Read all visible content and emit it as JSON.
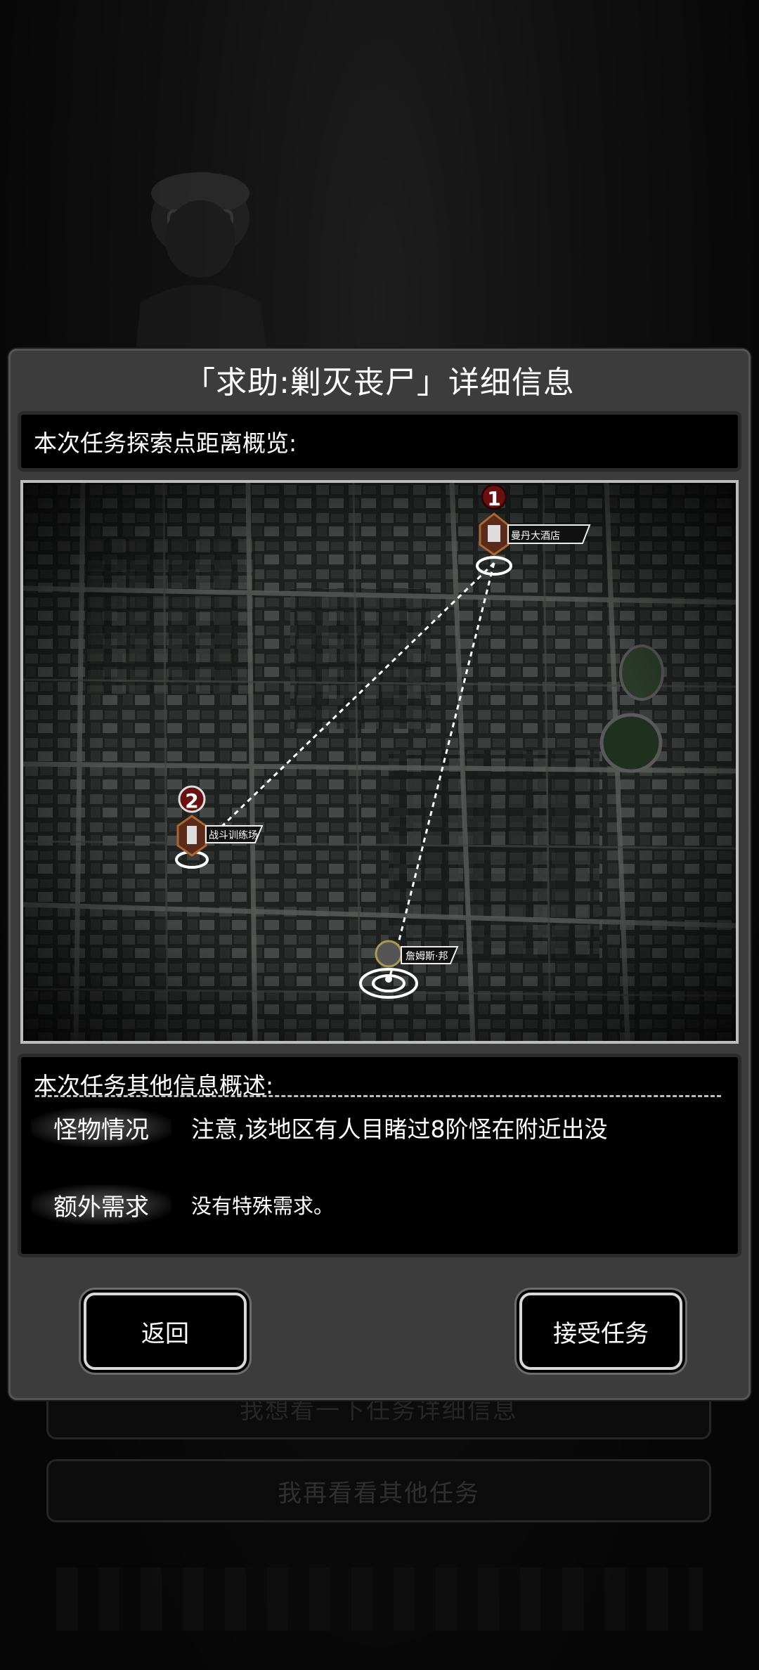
{
  "background": {
    "option_1": "我想看一下任务详细信息",
    "option_2": "我再看看其他任务"
  },
  "dialog": {
    "title": "「求助:剿灭丧尸」详细信息",
    "overview_label": "本次任务探索点距离概览:",
    "map": {
      "points": [
        {
          "number": "1",
          "name": "曼丹大酒店",
          "icon": "hotel-icon"
        },
        {
          "number": "2",
          "name": "战斗训练场",
          "icon": "building-icon"
        },
        {
          "name": "詹姆斯·邦",
          "icon": "player-location-icon"
        }
      ]
    },
    "info_label": "本次任务其他信息概述:",
    "monster_label": "怪物情况",
    "monster_value": "注意,该地区有人目睹过8阶怪在附近出没",
    "extra_label": "额外需求",
    "extra_value": "没有特殊需求。",
    "back_button": "返回",
    "accept_button": "接受任务"
  }
}
